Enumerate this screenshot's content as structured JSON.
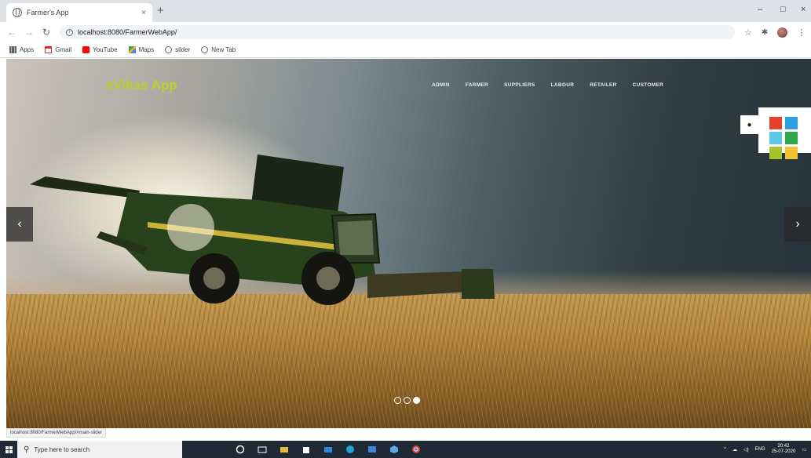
{
  "browser": {
    "tab_title": "Farmer's App",
    "tab_close": "×",
    "new_tab": "+",
    "url": "localhost:8080/FarmerWebApp/",
    "window_controls": {
      "minimize": "–",
      "maximize": "□",
      "close": "×"
    },
    "bookmarks": [
      {
        "label": "Apps",
        "icon": "apps-icon"
      },
      {
        "label": "Gmail",
        "icon": "gmail-icon"
      },
      {
        "label": "YouTube",
        "icon": "youtube-icon"
      },
      {
        "label": "Maps",
        "icon": "maps-icon"
      },
      {
        "label": "slider",
        "icon": "globe-icon"
      },
      {
        "label": "New Tab",
        "icon": "globe-icon"
      }
    ]
  },
  "site": {
    "brand": "eVikas App",
    "nav": [
      "ADMIN",
      "FARMER",
      "SUPPLIERS",
      "LABOUR",
      "RETAILER",
      "CUSTOMER"
    ],
    "carousel": {
      "prev": "‹",
      "next": "›",
      "slide_count": 3,
      "active_slide": 3
    },
    "color_swatches": [
      "#e8402f",
      "#2b9fe0",
      "#5bc8e6",
      "#33a84a",
      "#a7c52a",
      "#f2c230"
    ]
  },
  "status_bar_url": "localhost:8080/FarmerWebApp/#main-slider",
  "taskbar": {
    "search_placeholder": "Type here to search",
    "clock_time": "20:42",
    "clock_date": "25-07-2020",
    "language": "ENG"
  }
}
